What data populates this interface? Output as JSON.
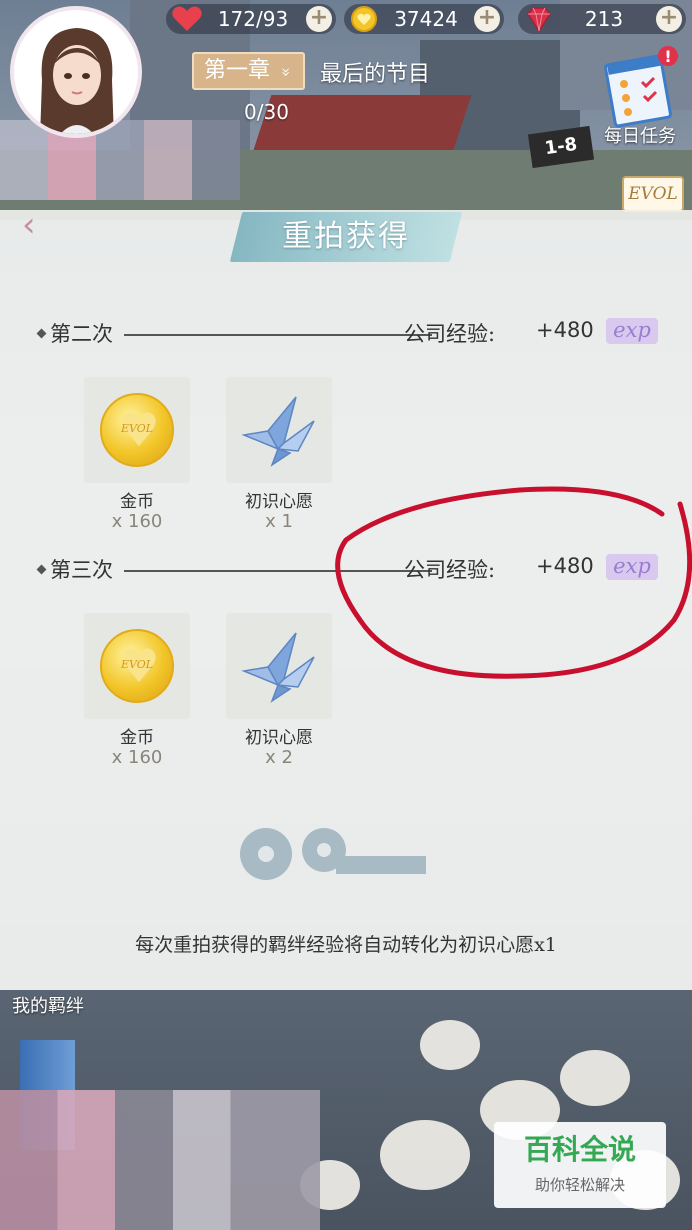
{
  "hud": {
    "stamina": "172/93",
    "gold": "37424",
    "diamonds": "213",
    "plus": "+"
  },
  "chapter": {
    "button_label": "第一章",
    "chevron": "»",
    "title": "最后的节目",
    "progress": "0/30",
    "stage_flag": "1-8"
  },
  "daily_task": {
    "label": "每日任务",
    "alert": "!"
  },
  "evol_badge": "EVOL",
  "panel": {
    "back": "‹",
    "title": "重拍获得",
    "sections": [
      {
        "name": "第二次",
        "exp_label": "公司经验:",
        "exp_value": "+480",
        "exp_tag": "exp",
        "rewards": [
          {
            "name": "金币",
            "qty": "x 160",
            "icon": "gold-coin-icon"
          },
          {
            "name": "初识心愿",
            "qty": "x 1",
            "icon": "paper-crane-icon"
          }
        ]
      },
      {
        "name": "第三次",
        "exp_label": "公司经验:",
        "exp_value": "+480",
        "exp_tag": "exp",
        "rewards": [
          {
            "name": "金币",
            "qty": "x 160",
            "icon": "gold-coin-icon"
          },
          {
            "name": "初识心愿",
            "qty": "x 2",
            "icon": "paper-crane-icon"
          }
        ]
      }
    ],
    "coin_emblem": "EVOL",
    "footnote": "每次重拍获得的羁绊经验将自动转化为初识心愿x1"
  },
  "bottom": {
    "bond_label": "我的羁绊"
  },
  "watermark": {
    "title": "百科全说",
    "subtitle": "助你轻松解决"
  },
  "colors": {
    "exp_tag": "#9b7dcf",
    "title_band": "#85b7c2",
    "annotation": "#c8102e",
    "chapter_button": "#d8b48a"
  }
}
